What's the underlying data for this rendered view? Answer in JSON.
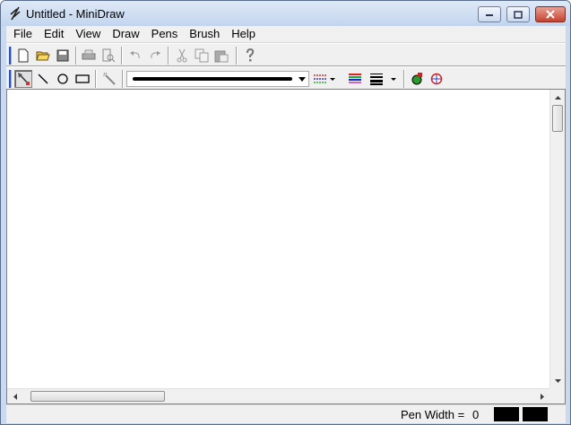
{
  "window": {
    "title": "Untitled - MiniDraw"
  },
  "menubar": {
    "items": [
      "File",
      "Edit",
      "View",
      "Draw",
      "Pens",
      "Brush",
      "Help"
    ]
  },
  "toolbar_standard": {
    "icons": [
      "new-icon",
      "open-icon",
      "save-icon",
      "print-icon",
      "print-preview-icon",
      "undo-icon",
      "redo-icon",
      "cut-icon",
      "copy-icon",
      "paste-icon",
      "help-icon"
    ]
  },
  "toolbar_draw": {
    "icons": [
      "select-tool-icon",
      "line-tool-icon",
      "ellipse-tool-icon",
      "rectangle-tool-icon",
      "magic-wand-icon",
      "pen-style-icon",
      "pen-color-icon",
      "pen-width-icon",
      "brush-color-icon",
      "brush-style-icon"
    ],
    "selected_tool": "select-tool-icon"
  },
  "statusbar": {
    "pen_width_label": "Pen Width =",
    "pen_width_value": "0"
  },
  "colors": {
    "title_gradient_top": "#dfe9f7",
    "close_button": "#c6422d",
    "chrome": "#f0f0f0",
    "canvas": "#ffffff"
  }
}
